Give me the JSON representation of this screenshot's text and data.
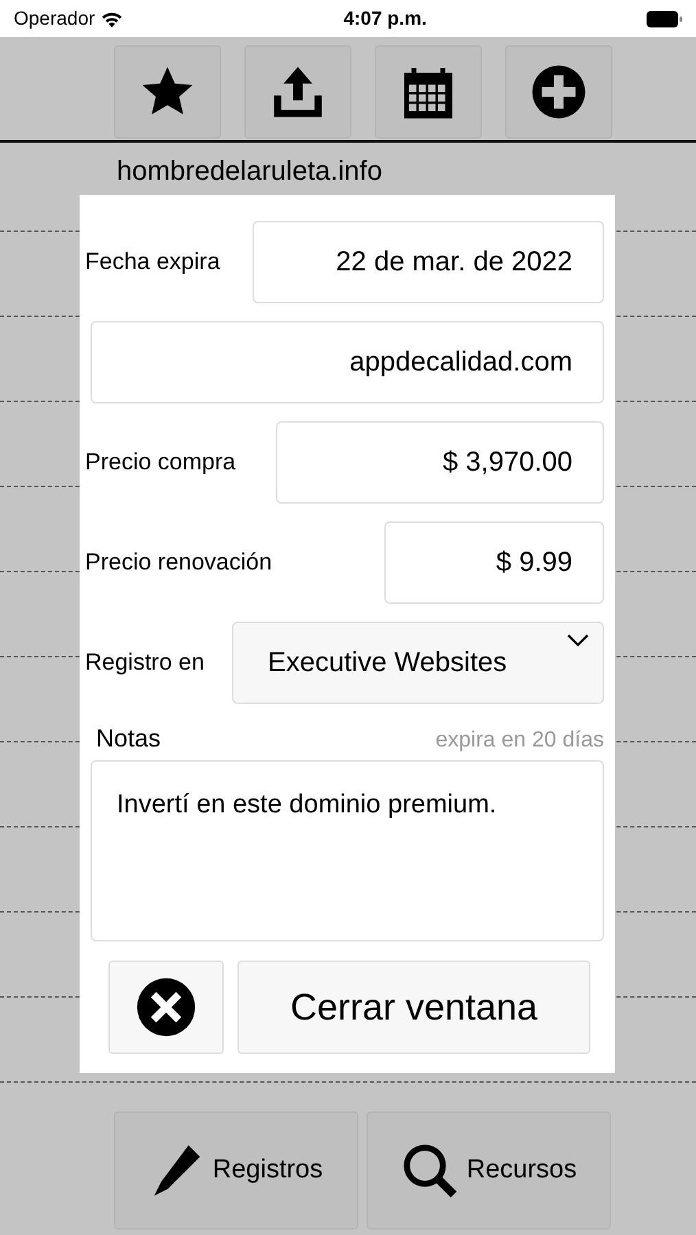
{
  "status_bar": {
    "carrier": "Operador",
    "time": "4:07 p.m."
  },
  "toolbar": {
    "buttons": [
      {
        "kind": "star"
      },
      {
        "kind": "share"
      },
      {
        "kind": "calendar"
      },
      {
        "kind": "add"
      }
    ]
  },
  "list": {
    "rows": [
      {
        "domain": "hombredelaruleta.info"
      }
    ]
  },
  "dialog": {
    "fields": [
      {
        "kind": "input",
        "label": "Fecha expira",
        "value": "22 de mar. de 2022"
      },
      {
        "kind": "input",
        "value": "appdecalidad.com"
      },
      {
        "kind": "input",
        "label": "Precio compra",
        "value": "$ 3,970.00"
      },
      {
        "kind": "input",
        "label": "Precio renovación",
        "value": "$ 9.99"
      },
      {
        "kind": "select",
        "label": "Registro en",
        "value": "Executive Websites"
      }
    ],
    "notes": {
      "label": "Notas",
      "hint": "expira en 20 días",
      "value": "Invertí en este dominio premium."
    },
    "buttons": [
      {
        "kind": "icon"
      },
      {
        "kind": "text",
        "label": "Cerrar ventana"
      }
    ]
  },
  "bottom_bar": {
    "buttons": [
      {
        "kind": "pencil",
        "label": "Registros"
      },
      {
        "kind": "search",
        "label": "Recursos"
      }
    ]
  }
}
